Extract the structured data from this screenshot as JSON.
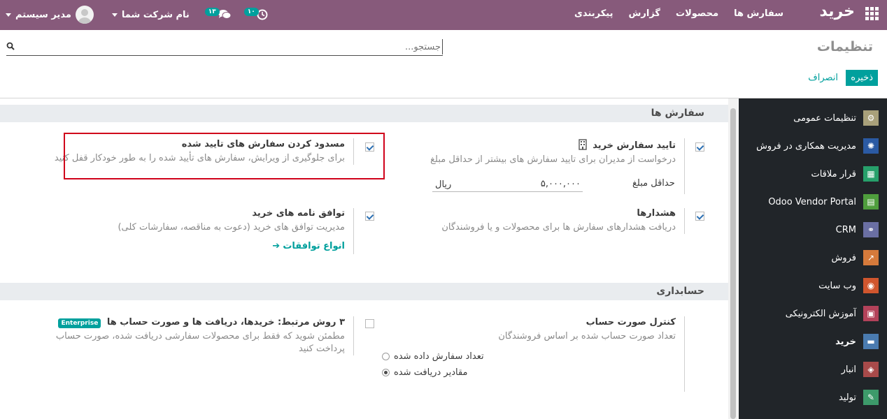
{
  "nav": {
    "brand": "خرید",
    "menu": [
      "سفارش ها",
      "محصولات",
      "گزارش",
      "پیکربندی"
    ],
    "user_name": "مدیر سیستم",
    "company_name": "نام شرکت شما",
    "chat_count": "۱۳",
    "activity_count": "۱۰"
  },
  "control_panel": {
    "title": "تنظیمات",
    "search_placeholder": "جستجو...",
    "save_label": "ذخیره",
    "cancel_label": "انصراف"
  },
  "sidebar": {
    "items": [
      {
        "label": "تنظیمات عمومی",
        "icon": "gear-icon",
        "color": "#a8a07a"
      },
      {
        "label": "مدیریت همکاری در فروش",
        "icon": "network-icon",
        "color": "#2b5aa3"
      },
      {
        "label": "قرار ملاقات",
        "icon": "calendar-icon",
        "color": "#27a06b"
      },
      {
        "label": "Odoo Vendor Portal",
        "icon": "grid-icon",
        "color": "#4f9e3d"
      },
      {
        "label": "CRM",
        "icon": "handshake-icon",
        "color": "#6a6fa3"
      },
      {
        "label": "فروش",
        "icon": "chart-icon",
        "color": "#d57a3b"
      },
      {
        "label": "وب سایت",
        "icon": "globe-icon",
        "color": "#d0562e"
      },
      {
        "label": "آموزش الکترونیکی",
        "icon": "board-icon",
        "color": "#b3425a"
      },
      {
        "label": "خرید",
        "icon": "card-icon",
        "color": "#4a7bb0"
      },
      {
        "label": "انبار",
        "icon": "box-icon",
        "color": "#a84a4a"
      },
      {
        "label": "تولید",
        "icon": "wrench-icon",
        "color": "#3d9a6a"
      }
    ],
    "active_index": 8
  },
  "sections": {
    "orders": {
      "title": "سفارش ها",
      "approval": {
        "title": "تایید سفارش خرید",
        "desc": "درخواست از مدیران برای تایید سفارش های بیشتر از حداقل مبلغ",
        "min_label": "حداقل مبلغ",
        "min_value": "۵,۰۰۰,۰۰۰",
        "currency": "ریال",
        "checked": true
      },
      "lock": {
        "title": "مسدود کردن سفارش های تایید شده",
        "desc": "برای جلوگیری از ویرایش، سفارش های تأیید شده را به طور خودکار قفل کنید",
        "checked": true
      },
      "warnings": {
        "title": "هشدارها",
        "desc": "دریافت هشدارهای سفارش ها برای محصولات و یا فروشندگان",
        "checked": true
      },
      "agreements": {
        "title": "توافق نامه های خرید",
        "desc": "مدیریت توافق های خرید (دعوت به مناقصه، سفارشات کلی)",
        "link": "انواع توافقات",
        "checked": true
      }
    },
    "accounting": {
      "title": "حسابداری",
      "bill_control": {
        "title": "کنترل صورت حساب",
        "desc": "تعداد صورت حساب شده بر اساس فروشندگان",
        "options": [
          "تعداد سفارش داده شده",
          "مقادیر دریافت شده"
        ],
        "selected_index": 1
      },
      "three_way": {
        "title": "۳ روش مرتبط: خریدها، دریافت ها و صورت حساب ها",
        "badge": "Enterprise",
        "desc": "مطمئن شوید که فقط برای محصولات سفارشی دریافت شده، صورت حساب پرداخت کنید",
        "checked": false
      }
    }
  }
}
